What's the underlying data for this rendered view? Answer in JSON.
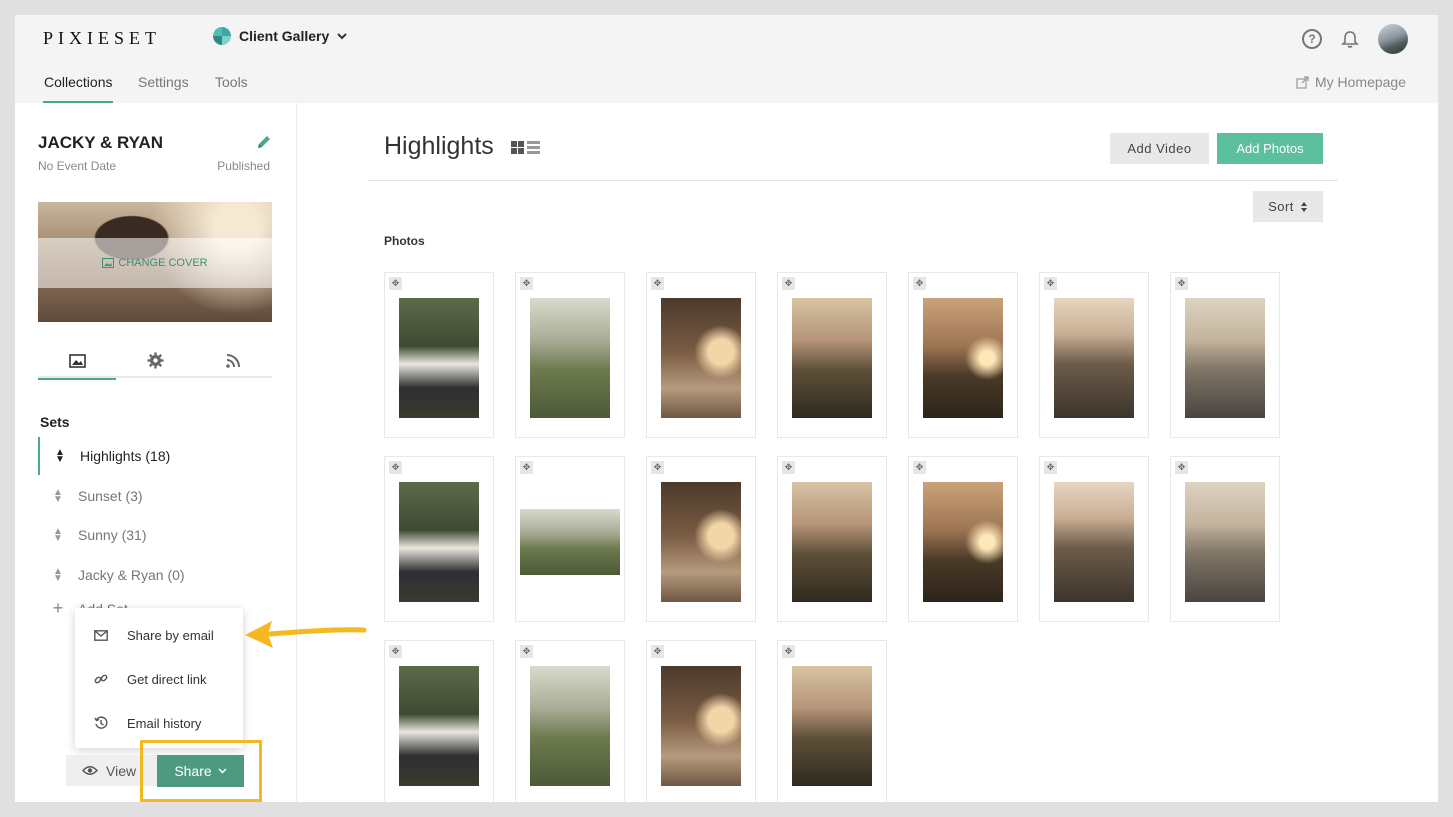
{
  "app": {
    "logo": "PIXIESET",
    "switcher_label": "Client Gallery"
  },
  "icons": {
    "help": "help-circle-icon",
    "notifications": "bell-icon",
    "move": "move-icon",
    "external_link": "external-link-icon"
  },
  "subnav": {
    "tabs": [
      "Collections",
      "Settings",
      "Tools"
    ],
    "active_tab": "Collections",
    "homepage_link": "My Homepage"
  },
  "collection": {
    "title": "JACKY & RYAN",
    "event_date": "No Event Date",
    "status": "Published",
    "change_cover_label": "CHANGE COVER"
  },
  "sidebar": {
    "tabs": [
      "photos-icon",
      "gear-icon",
      "rss-icon"
    ],
    "sets_heading": "Sets",
    "sets": [
      {
        "label": "Highlights (18)",
        "active": true
      },
      {
        "label": "Sunset (3)",
        "active": false
      },
      {
        "label": "Sunny (31)",
        "active": false
      },
      {
        "label": "Jacky & Ryan (0)",
        "active": false
      }
    ],
    "add_set_label": "Add Set"
  },
  "share_menu": {
    "items": [
      {
        "label": "Share by email",
        "icon": "envelope-icon"
      },
      {
        "label": "Get direct link",
        "icon": "link-icon"
      },
      {
        "label": "Email history",
        "icon": "history-icon"
      }
    ]
  },
  "footer_buttons": {
    "view_label": "View",
    "share_label": "Share"
  },
  "main": {
    "title": "Highlights",
    "add_video_label": "Add Video",
    "add_photos_label": "Add Photos",
    "sort_label": "Sort",
    "photos_label": "Photos",
    "accent_color": "#5cbf9f",
    "highlight_color": "#f5b820",
    "photos": [
      {
        "orientation": "portrait",
        "scene": "wedding couple with bouquet in forest"
      },
      {
        "orientation": "portrait",
        "scene": "couple with goat in field"
      },
      {
        "orientation": "portrait",
        "scene": "woman profile at sunset"
      },
      {
        "orientation": "portrait",
        "scene": "sunset over hills"
      },
      {
        "orientation": "portrait",
        "scene": "sunset valley"
      },
      {
        "orientation": "portrait",
        "scene": "couple embracing on road"
      },
      {
        "orientation": "portrait",
        "scene": "couple standing on road"
      },
      {
        "orientation": "portrait",
        "scene": "couple back to back"
      },
      {
        "orientation": "landscape",
        "scene": "couple close up"
      },
      {
        "orientation": "portrait",
        "scene": "couple in neutral outfits"
      },
      {
        "orientation": "portrait",
        "scene": "couple standing at sunset"
      },
      {
        "orientation": "portrait",
        "scene": "couple embracing at sunset"
      },
      {
        "orientation": "portrait",
        "scene": "couple walking on road"
      },
      {
        "orientation": "portrait",
        "scene": "couple holding hands on road"
      },
      {
        "orientation": "portrait",
        "scene": "couple walking away at sunset"
      },
      {
        "orientation": "portrait",
        "scene": "couple walking on road sunset"
      },
      {
        "orientation": "portrait",
        "scene": "couple holding hands walking"
      },
      {
        "orientation": "portrait",
        "scene": "couple walking on winding road"
      }
    ]
  }
}
